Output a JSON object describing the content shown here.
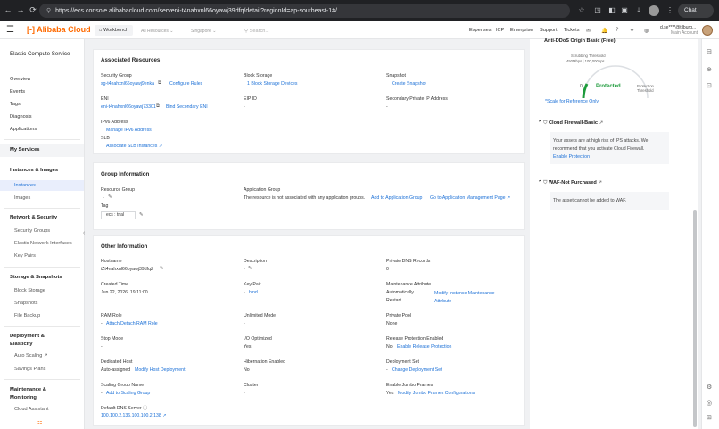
{
  "browser": {
    "url": "https://ecs.console.alibabacloud.com/server/i-t4nahxnl66oyawj39dfq/detail?regionId=ap-southeast-1#/",
    "chat_label": "Chat"
  },
  "topbar": {
    "brand": "Alibaba Cloud",
    "workbench": "Workbench",
    "resources_dd": "All Resources",
    "region_dd": "Singapore",
    "search_placeholder": "Search...",
    "links": [
      "Expenses",
      "ICP",
      "Enterprise",
      "Support",
      "Tickets"
    ],
    "account_line1": "d.se****@tilburg...",
    "account_line2": "Main Account"
  },
  "sidebar": {
    "title": "Elastic Compute Service",
    "overview": "Overview",
    "events": "Events",
    "tags": "Tags",
    "diagnosis": "Diagnosis",
    "applications": "Applications",
    "my_services": "My Services",
    "instances_images": "Instances & Images",
    "instances": "Instances",
    "images": "Images",
    "network_security": "Network & Security",
    "security_groups": "Security Groups",
    "eni": "Elastic Network Interfaces",
    "key_pairs": "Key Pairs",
    "storage_snapshots": "Storage & Snapshots",
    "block_storage": "Block Storage",
    "snapshots": "Snapshots",
    "file_backup": "File Backup",
    "deployment_elasticity": "Deployment & Elasticity",
    "auto_scaling": "Auto Scaling",
    "savings_plans": "Savings Plans",
    "maintenance_monitoring": "Maintenance & Monitoring",
    "cloud_assistant": "Cloud Assistant"
  },
  "associated": {
    "title": "Associated Resources",
    "security_group_label": "Security Group",
    "security_group_value": "sg-t4nahxnl66oyawj9enka",
    "configure_rules": "Configure Rules",
    "block_storage_label": "Block Storage",
    "block_storage_value": "1 Block Storage Devices",
    "snapshot_label": "Snapshot",
    "create_snapshot": "Create Snapshot",
    "eni_label": "ENI",
    "eni_value": "eni-t4nahxnl66oyawj73301",
    "bind_secondary_eni": "Bind Secondary ENI",
    "eip_label": "EIP ID",
    "eip_value": "-",
    "secondary_ip_label": "Secondary Private IP Address",
    "secondary_ip_value": "-",
    "ipv6_label": "IPv6 Address",
    "manage_ipv6": "Manage IPv6 Address",
    "slb_label": "SLB",
    "associate_slb": "Associate SLB Instances"
  },
  "group": {
    "title": "Group Information",
    "resource_group_label": "Resource Group",
    "resource_group_value": "-",
    "application_group_label": "Application Group",
    "application_group_text": "The resource is not associated with any application groups.",
    "add_to_app_group": "Add to Application Group",
    "go_to_app_mgmt": "Go to Application Management Page",
    "tag_label": "Tag",
    "tag_value": "ecs : trial"
  },
  "other": {
    "title": "Other Information",
    "hostname_label": "Hostname",
    "hostname_value": "iZt4nahxnl66oyawj39dfqZ",
    "description_label": "Description",
    "description_value": "-",
    "private_dns_label": "Private DNS Records",
    "private_dns_value": "0",
    "created_label": "Created Time",
    "created_value": "Jun 22, 2026, 19:11:00",
    "keypair_label": "Key Pair",
    "keypair_value": "bind",
    "maint_label": "Maintenance Attribute",
    "maint_automatically": "Automatically",
    "maint_restart": "Restart",
    "maint_link": "Modify Instance Maintenance Attribute",
    "ram_label": "RAM Role",
    "ram_link": "Attach/Detach RAM Role",
    "unlimited_label": "Unlimited Mode",
    "unlimited_value": "-",
    "private_pool_label": "Private Pool",
    "private_pool_value": "None",
    "stop_mode_label": "Stop Mode",
    "stop_mode_value": "-",
    "io_opt_label": "I/O Optimized",
    "io_opt_value": "Yes",
    "release_prot_label": "Release Protection Enabled",
    "release_prot_value": "No",
    "release_prot_link": "Enable Release Protection",
    "dedicated_label": "Dedicated Host",
    "dedicated_value": "Auto-assigned",
    "dedicated_link": "Modify Host Deployment",
    "hibernation_label": "Hibernation Enabled",
    "hibernation_value": "No",
    "deploy_set_label": "Deployment Set",
    "deploy_set_link": "Change Deployment Set",
    "scaling_group_label": "Scaling Group Name",
    "scaling_group_link": "Add to Scaling Group",
    "cluster_label": "Cluster",
    "cluster_value": "-",
    "jumbo_label": "Enable Jumbo Frames",
    "jumbo_value": "Yes",
    "jumbo_link": "Modify Jumbo Frames Configurations",
    "dns_label": "Default DNS Server",
    "dns_value": "100.100.2.136,100.100.2.138"
  },
  "right": {
    "anti_ddos_title": "Anti-DDoS Origin Basic (Free)",
    "scrubbing_label": "Scrubbing Threshold",
    "scrubbing_value": "450Mbps | 100,000pps",
    "gauge_zero": "0",
    "protected": "Protected",
    "protection_threshold": "Protection Threshold",
    "scale_note": "*Scale for Reference Only",
    "firewall_title": "Cloud Firewall-Basic",
    "firewall_text1": "Your assets are at high risk of IPS attacks. We",
    "firewall_text2": "recommend that you activate Cloud Firewall.",
    "enable_protection": "Enable Protection",
    "waf_title": "WAF-Not Purchased",
    "waf_text": "The asset cannot be added to WAF."
  },
  "colors": {
    "accent": "#1a6fd6",
    "brand": "#ff6a00",
    "protected": "#1e9b3c"
  }
}
